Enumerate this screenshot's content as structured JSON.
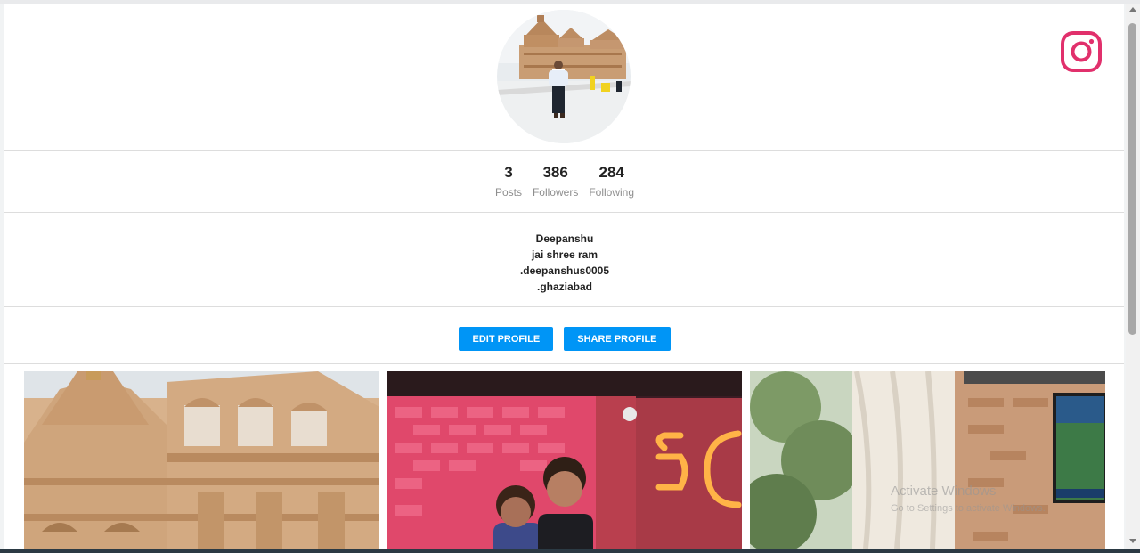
{
  "profile": {
    "stats": [
      {
        "value": "3",
        "label": "Posts"
      },
      {
        "value": "386",
        "label": "Followers"
      },
      {
        "value": "284",
        "label": "Following"
      }
    ],
    "bio": {
      "name": "Deepanshu",
      "line1": "jai shree ram",
      "line2": ".deepanshus0005",
      "line3": ".ghaziabad"
    }
  },
  "buttons": {
    "edit": "EDIT PROFILE",
    "share": "SHARE PROFILE"
  },
  "watermark": {
    "title": "Activate Windows",
    "subtitle": "Go to Settings to activate Windows."
  },
  "icons": {
    "brand": "instagram-icon"
  },
  "colors": {
    "accent": "#0095f6",
    "instagram": "#e1306c"
  }
}
